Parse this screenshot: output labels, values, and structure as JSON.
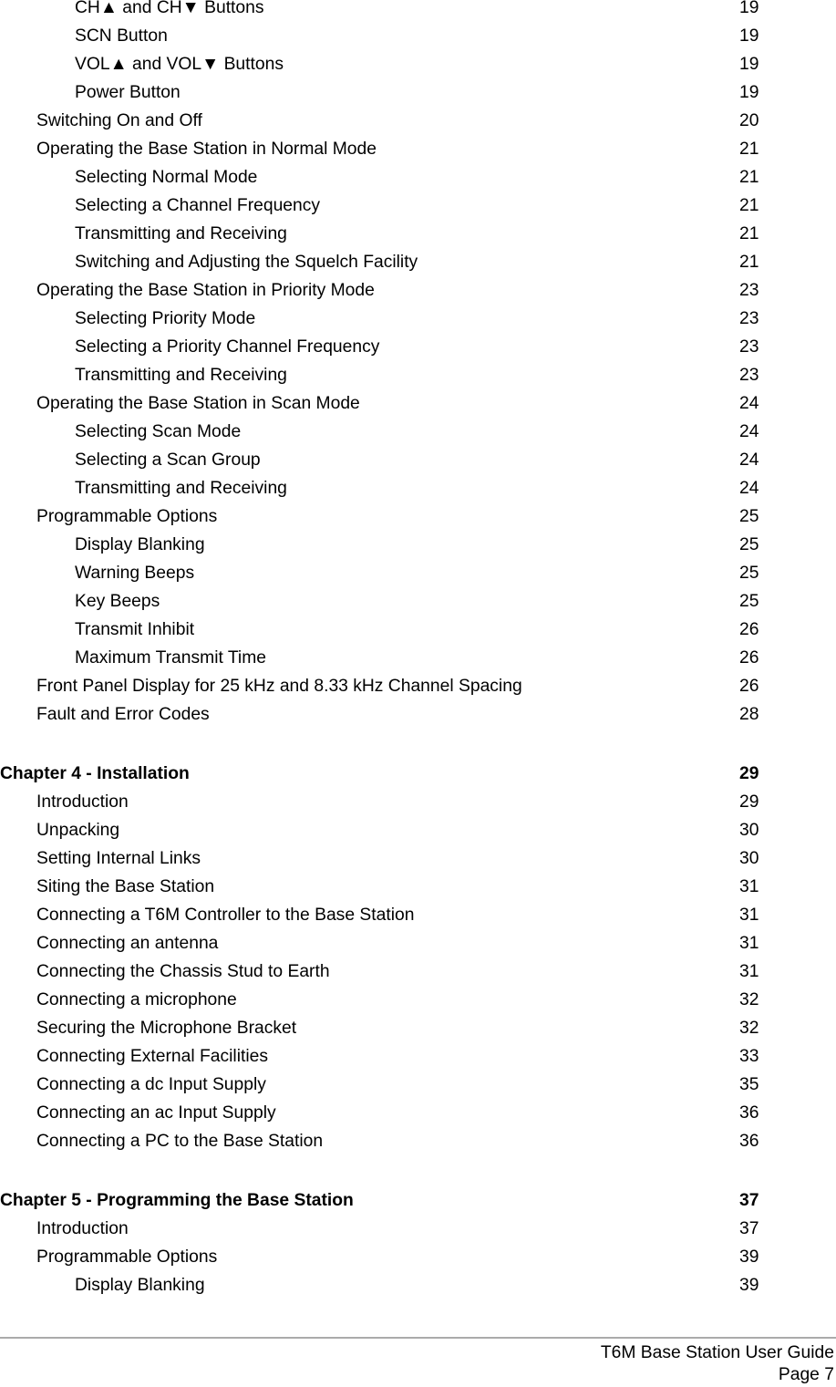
{
  "document": {
    "type": "table-of-contents",
    "entries": [
      {
        "level": 2,
        "title": "CH▲ and CH▼ Buttons",
        "page": "19"
      },
      {
        "level": 2,
        "title": "SCN Button",
        "page": "19"
      },
      {
        "level": 2,
        "title": "VOL▲ and VOL▼ Buttons",
        "page": "19"
      },
      {
        "level": 2,
        "title": "Power Button",
        "page": "19"
      },
      {
        "level": 1,
        "title": "Switching On and Off",
        "page": "20"
      },
      {
        "level": 1,
        "title": "Operating the Base Station in Normal Mode",
        "page": "21"
      },
      {
        "level": 2,
        "title": "Selecting Normal Mode",
        "page": "21"
      },
      {
        "level": 2,
        "title": "Selecting a Channel Frequency",
        "page": "21"
      },
      {
        "level": 2,
        "title": "Transmitting and Receiving",
        "page": "21"
      },
      {
        "level": 2,
        "title": "Switching and Adjusting the Squelch Facility",
        "page": "21"
      },
      {
        "level": 1,
        "title": "Operating the Base Station in Priority Mode",
        "page": "23"
      },
      {
        "level": 2,
        "title": "Selecting Priority Mode",
        "page": "23"
      },
      {
        "level": 2,
        "title": "Selecting a Priority Channel Frequency",
        "page": "23"
      },
      {
        "level": 2,
        "title": "Transmitting and Receiving",
        "page": "23"
      },
      {
        "level": 1,
        "title": "Operating the Base Station in Scan Mode",
        "page": "24"
      },
      {
        "level": 2,
        "title": "Selecting Scan Mode",
        "page": "24"
      },
      {
        "level": 2,
        "title": "Selecting a Scan Group",
        "page": "24"
      },
      {
        "level": 2,
        "title": "Transmitting and Receiving",
        "page": "24"
      },
      {
        "level": 1,
        "title": "Programmable Options",
        "page": "25"
      },
      {
        "level": 2,
        "title": "Display Blanking",
        "page": "25"
      },
      {
        "level": 2,
        "title": "Warning Beeps",
        "page": "25"
      },
      {
        "level": 2,
        "title": "Key Beeps",
        "page": "25"
      },
      {
        "level": 2,
        "title": "Transmit Inhibit",
        "page": "26"
      },
      {
        "level": 2,
        "title": "Maximum Transmit Time",
        "page": "26"
      },
      {
        "level": 1,
        "title": "Front Panel Display for 25 kHz and 8.33 kHz Channel Spacing",
        "page": "26"
      },
      {
        "level": 1,
        "title": "Fault and Error Codes",
        "page": "28"
      },
      {
        "level": 0,
        "title": "Chapter 4 - Installation",
        "page": "29"
      },
      {
        "level": 1,
        "title": "Introduction",
        "page": "29"
      },
      {
        "level": 1,
        "title": "Unpacking",
        "page": "30"
      },
      {
        "level": 1,
        "title": "Setting Internal Links",
        "page": "30"
      },
      {
        "level": 1,
        "title": "Siting the Base Station",
        "page": "31"
      },
      {
        "level": 1,
        "title": "Connecting a T6M Controller to the Base Station",
        "page": "31"
      },
      {
        "level": 1,
        "title": "Connecting an antenna",
        "page": "31"
      },
      {
        "level": 1,
        "title": "Connecting the Chassis Stud to Earth",
        "page": "31"
      },
      {
        "level": 1,
        "title": "Connecting a microphone",
        "page": "32"
      },
      {
        "level": 1,
        "title": "Securing the Microphone Bracket",
        "page": "32"
      },
      {
        "level": 1,
        "title": "Connecting External Facilities",
        "page": "33"
      },
      {
        "level": 1,
        "title": "Connecting a dc Input Supply",
        "page": "35"
      },
      {
        "level": 1,
        "title": "Connecting an ac Input Supply",
        "page": "36"
      },
      {
        "level": 1,
        "title": "Connecting a PC to the Base Station",
        "page": "36"
      },
      {
        "level": 0,
        "title": "Chapter 5 - Programming the Base Station",
        "page": "37"
      },
      {
        "level": 1,
        "title": "Introduction",
        "page": "37"
      },
      {
        "level": 1,
        "title": "Programmable Options",
        "page": "39"
      },
      {
        "level": 2,
        "title": "Display Blanking",
        "page": "39"
      }
    ]
  },
  "footer": {
    "document_title": "T6M Base Station User Guide",
    "page_label": "Page 7"
  }
}
